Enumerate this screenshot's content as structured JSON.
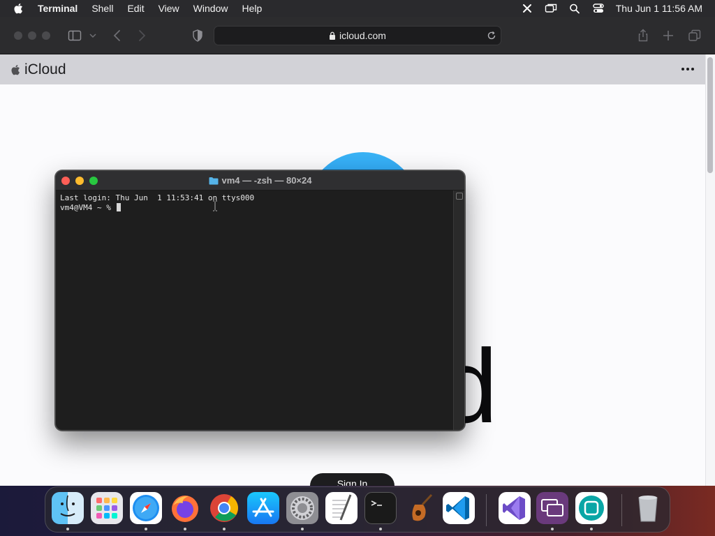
{
  "menubar": {
    "app_name": "Terminal",
    "items": [
      "Shell",
      "Edit",
      "View",
      "Window",
      "Help"
    ],
    "clock": "Thu Jun 1  11:56 AM"
  },
  "safari": {
    "address": "icloud.com",
    "page": {
      "brand": "iCloud",
      "big_text": "oud",
      "button_label": "Sign In"
    }
  },
  "terminal": {
    "title": "vm4 — -zsh — 80×24",
    "lines": [
      "Last login: Thu Jun  1 11:53:41 on ttys000",
      "vm4@VM4 ~ % "
    ]
  },
  "dock": {
    "apps": [
      {
        "name": "Finder",
        "icon": "finder-icon",
        "running": true
      },
      {
        "name": "Launchpad",
        "icon": "launchpad-icon",
        "running": false
      },
      {
        "name": "Safari",
        "icon": "safari-icon",
        "running": true
      },
      {
        "name": "Firefox",
        "icon": "firefox-icon",
        "running": true
      },
      {
        "name": "Google Chrome",
        "icon": "chrome-icon",
        "running": true
      },
      {
        "name": "App Store",
        "icon": "app-store-icon",
        "running": false
      },
      {
        "name": "System Settings",
        "icon": "settings-icon",
        "running": true
      },
      {
        "name": "TextEdit",
        "icon": "textedit-icon",
        "running": false
      },
      {
        "name": "Terminal",
        "icon": "terminal-icon",
        "running": true
      },
      {
        "name": "Instruments",
        "icon": "instruments-icon",
        "running": false
      },
      {
        "name": "Visual Studio Code",
        "icon": "vscode-icon",
        "running": false
      },
      {
        "name": "Visual Studio",
        "icon": "visual-studio-icon",
        "running": false
      },
      {
        "name": "Screen Sharing",
        "icon": "screen-sharing-icon",
        "running": true
      },
      {
        "name": "Remote App",
        "icon": "remote-app-icon",
        "running": true
      },
      {
        "name": "Trash",
        "icon": "trash-icon",
        "running": false
      }
    ]
  }
}
